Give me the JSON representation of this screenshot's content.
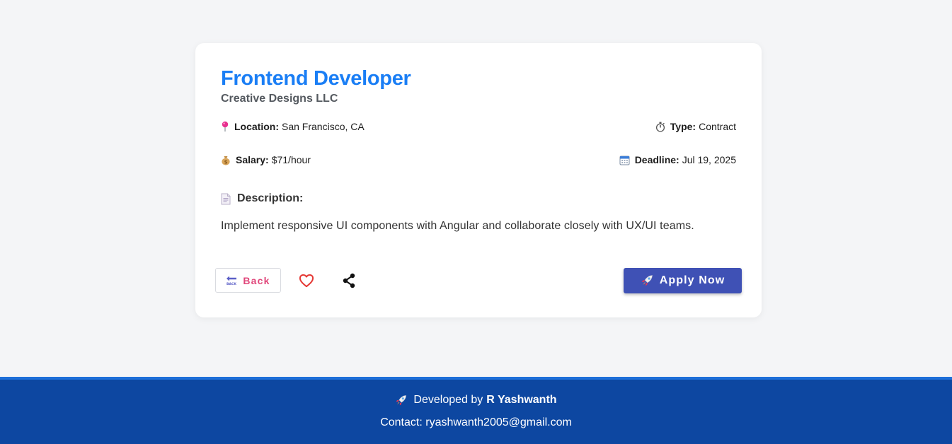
{
  "job": {
    "title": "Frontend Developer",
    "company": "Creative Designs LLC",
    "location_label": "Location:",
    "location": "San Francisco, CA",
    "type_label": "Type:",
    "type": "Contract",
    "salary_label": "Salary:",
    "salary": "$71/hour",
    "deadline_label": "Deadline:",
    "deadline": "Jul 19, 2025",
    "description_label": "Description:",
    "description": "Implement responsive UI components with Angular and collaborate closely with UX/UI teams."
  },
  "actions": {
    "back_label": "Back",
    "apply_label": "Apply Now"
  },
  "icons": {
    "location": "pushpin-icon",
    "type": "stopwatch-icon",
    "salary": "money-bag-icon",
    "deadline": "calendar-icon",
    "description": "page-icon",
    "back": "back-arrow-icon",
    "favorite": "heart-icon",
    "share": "share-icon",
    "apply": "rocket-icon",
    "footer": "rocket-icon"
  },
  "footer": {
    "developed_by_prefix": "Developed by",
    "author": "R Yashwanth",
    "contact": "Contact: ryashwanth2005@gmail.com"
  },
  "colors": {
    "title": "#1a7ef5",
    "apply_button": "#3f51b5",
    "back_text": "#e0467a",
    "footer_bg": "#0d47a1",
    "page_bg": "#f4f5f7"
  }
}
